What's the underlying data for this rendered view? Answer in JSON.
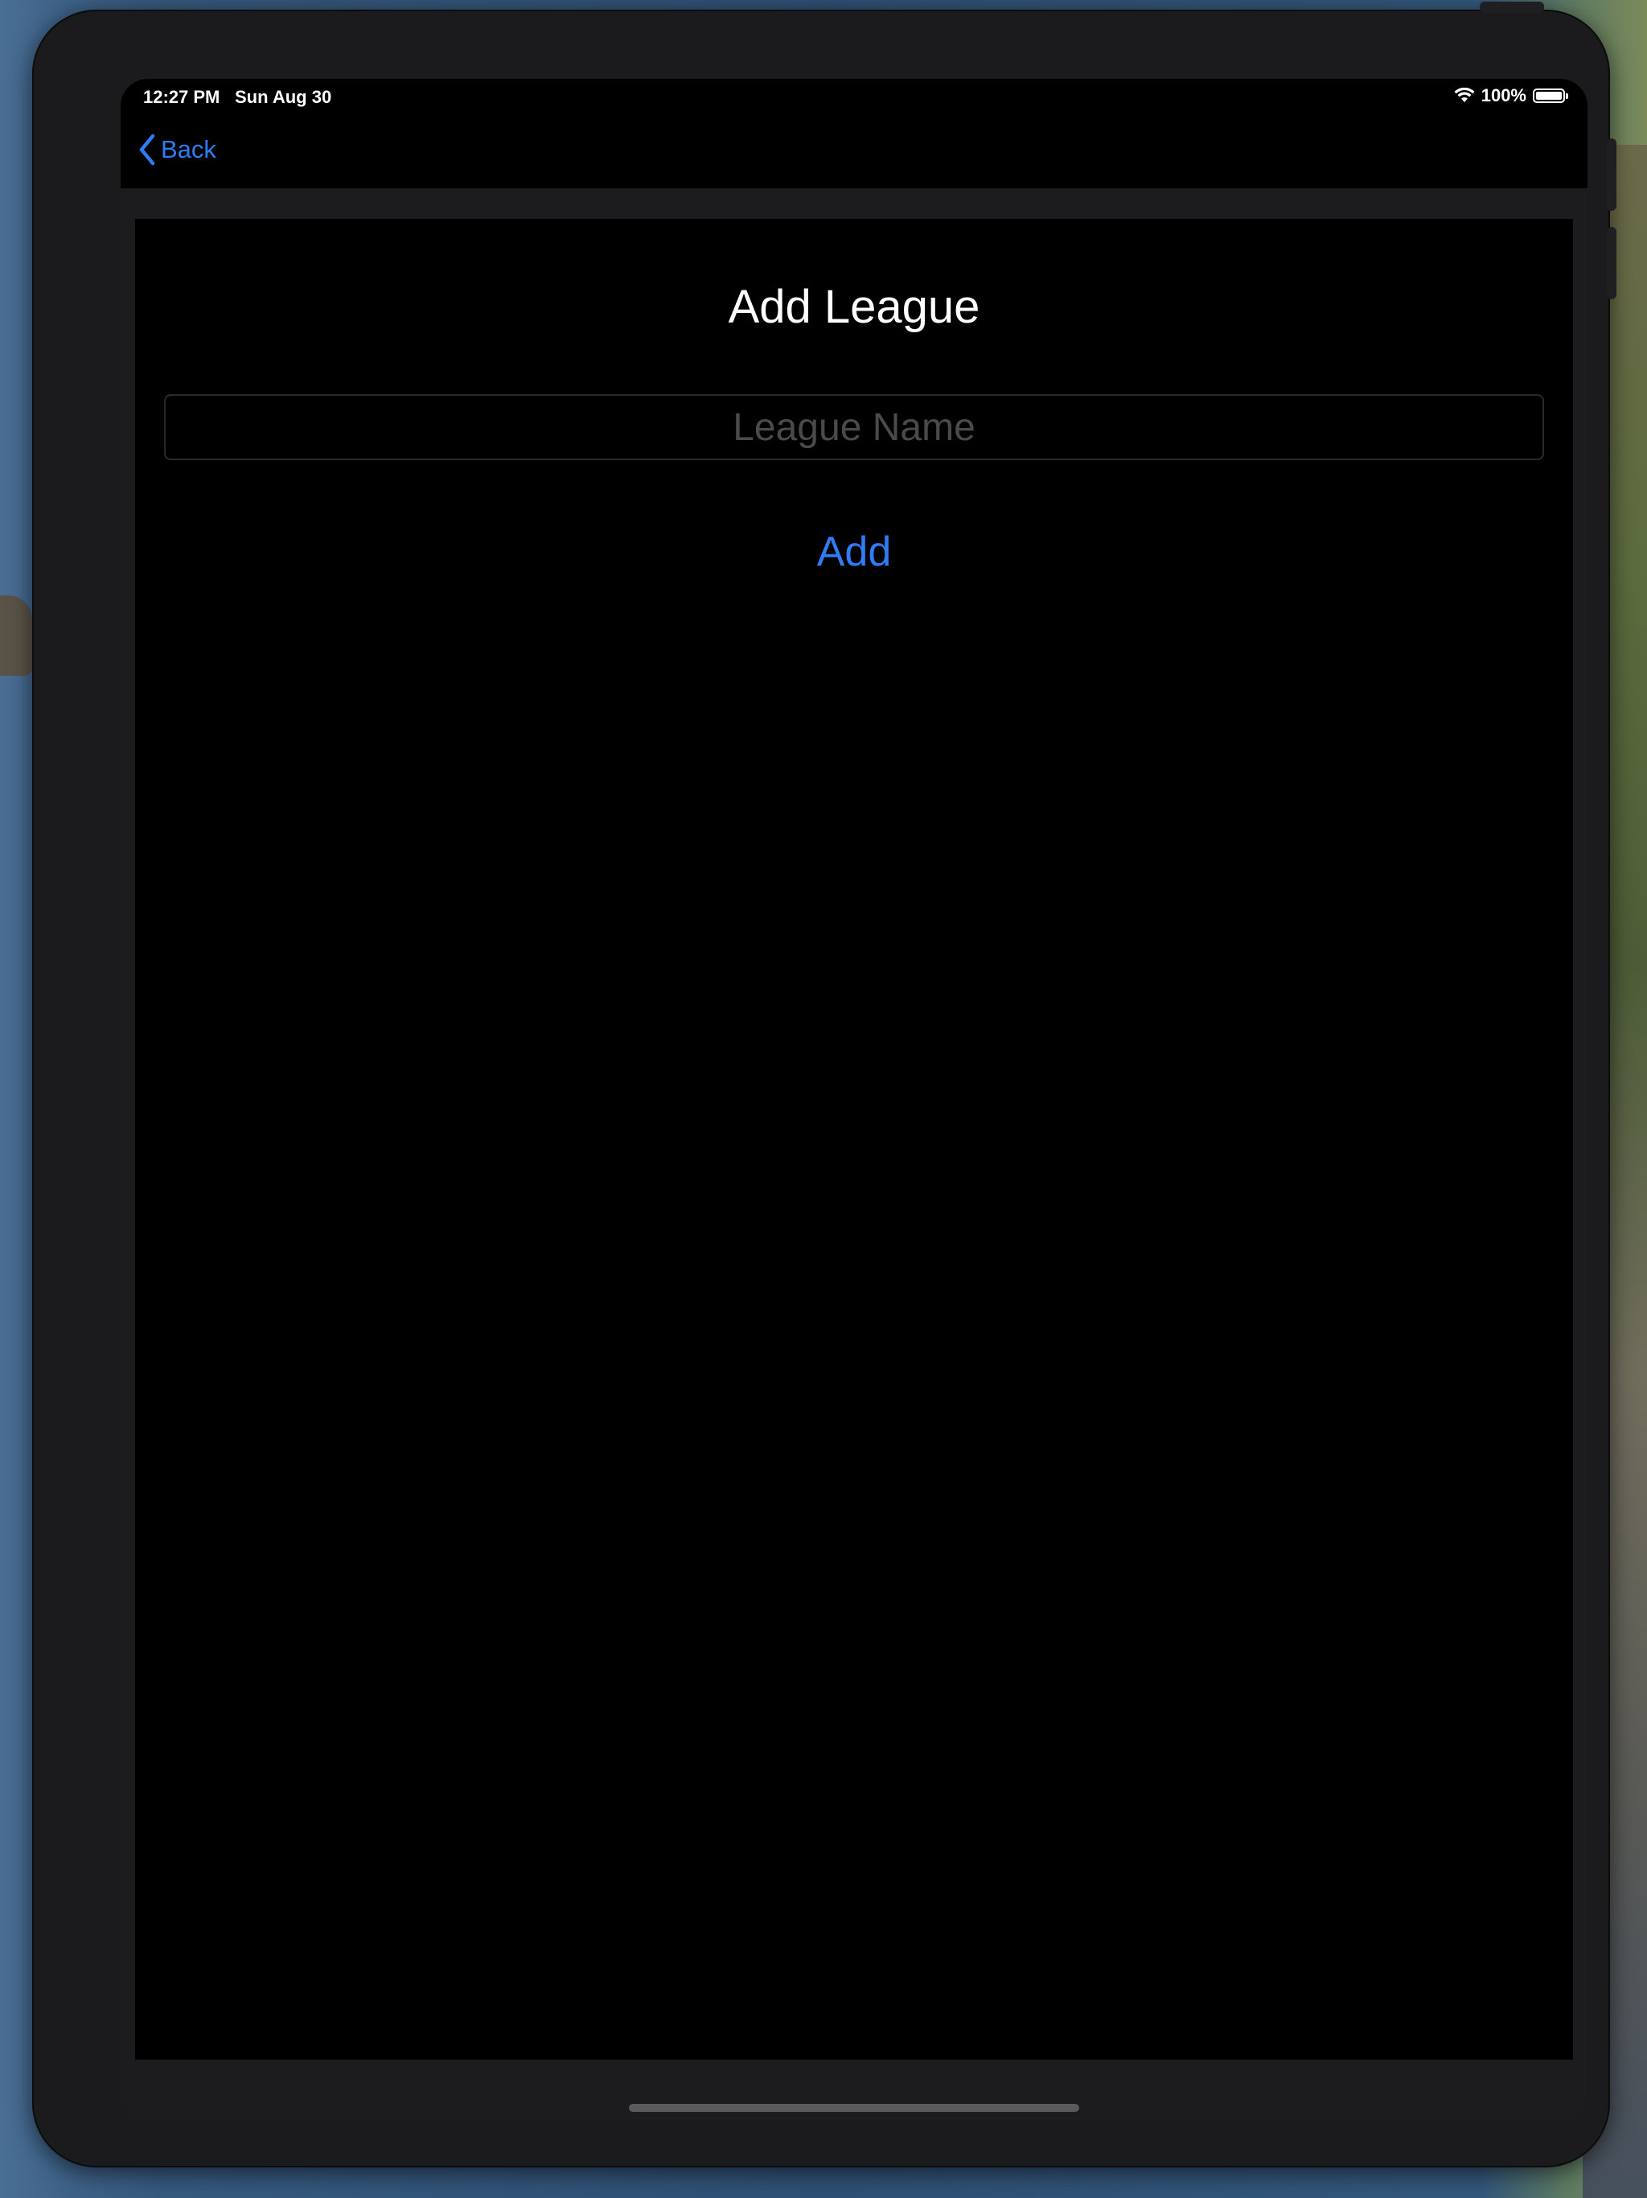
{
  "status_bar": {
    "time": "12:27 PM",
    "date": "Sun Aug 30",
    "battery": "100%",
    "wifi_icon": "wifi-icon",
    "battery_icon": "battery-icon"
  },
  "nav": {
    "back_label": "Back",
    "back_icon": "chevron-left-icon"
  },
  "page": {
    "title": "Add League",
    "league_name_placeholder": "League Name",
    "league_name_value": "",
    "add_label": "Add"
  },
  "colors": {
    "accent": "#2f7cf6",
    "background": "#000000",
    "device_frame": "#1b1b1d"
  }
}
